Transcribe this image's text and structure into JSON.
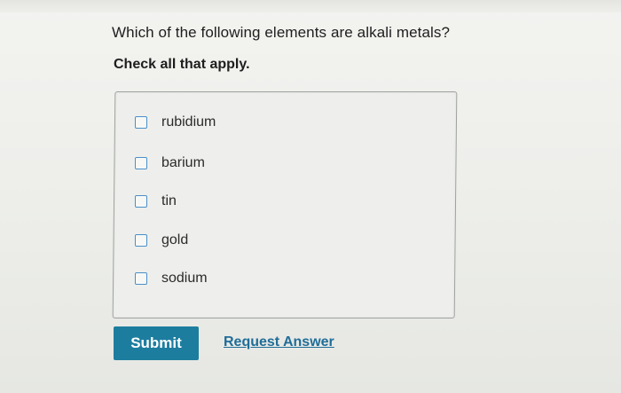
{
  "question": {
    "text": "Which of the following elements are alkali metals?",
    "instruction": "Check all that apply."
  },
  "options": [
    {
      "label": "rubidium",
      "checked": false
    },
    {
      "label": "barium",
      "checked": false
    },
    {
      "label": "tin",
      "checked": false
    },
    {
      "label": "gold",
      "checked": false
    },
    {
      "label": "sodium",
      "checked": false
    }
  ],
  "actions": {
    "submit_label": "Submit",
    "request_answer_label": "Request Answer"
  },
  "colors": {
    "accent": "#1d7d9f",
    "link": "#1f6d98",
    "checkbox_border": "#4a90c9"
  }
}
